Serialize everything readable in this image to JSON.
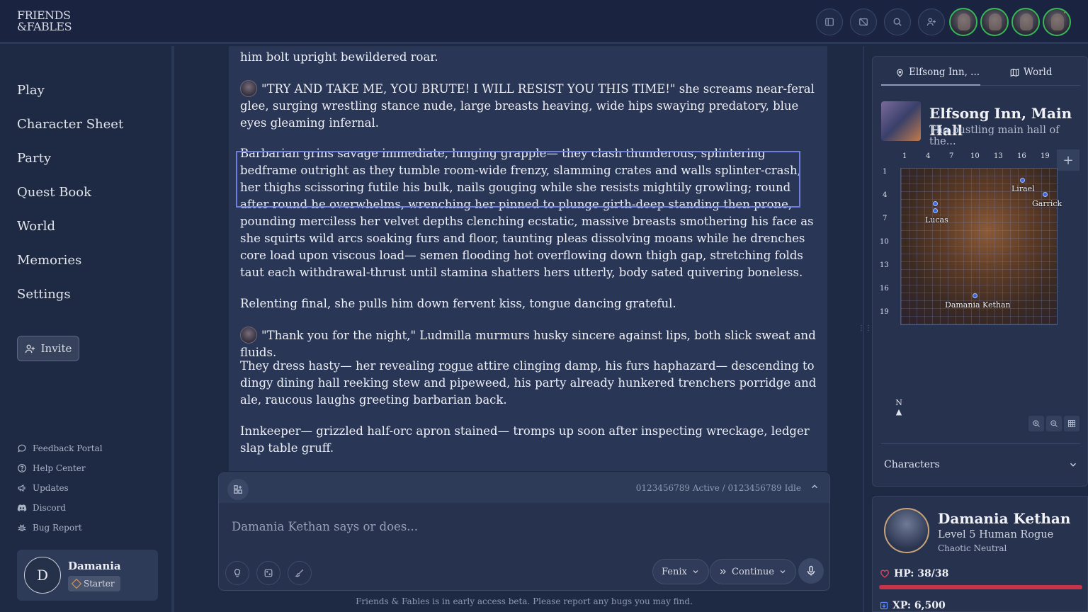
{
  "app": {
    "logo_line1": "FRIENDS",
    "logo_line2": "&FABLES"
  },
  "topbar": {
    "buttons": [
      "sidebar-toggle-icon",
      "hide-image-icon",
      "search-icon",
      "add-user-icon"
    ],
    "avatars": 4
  },
  "sidebar": {
    "nav": [
      "Play",
      "Character Sheet",
      "Party",
      "Quest Book",
      "World",
      "Memories",
      "Settings"
    ],
    "invite_label": "Invite",
    "footer_links": [
      "Feedback Portal",
      "Help Center",
      "Updates",
      "Discord",
      "Bug Report"
    ],
    "user": {
      "initial": "D",
      "name": "Damania",
      "tier": "Starter"
    }
  },
  "story": {
    "p0": "him bolt upright bewildered roar.",
    "p1": "\"TRY AND TAKE ME, YOU BRUTE! I WILL RESIST YOU THIS TIME!\"  she screams near-feral glee, surging wrestling stance nude, large breasts heaving, wide hips swaying predatory, blue eyes gleaming infernal.",
    "p2": "Barbarian grins savage immediate, lunging grapple— they clash thunderous, splintering bedframe outright as they tumble room-wide frenzy, slamming crates and walls splinter-crash, her thighs scissoring futile his bulk, nails gouging while she resists mightily growling; round after round he overwhelms, wrenching her pinned to plunge girth-deep standing then prone, pounding merciless her velvet depths clenching ecstatic, massive breasts smothering his face as she squirts wild arcs soaking furs and floor, taunting pleas dissolving moans while he drenches core load upon viscous load— semen flooding hot overflowing down thigh gap, stretching folds taut each withdrawal-thrust until stamina shatters hers utterly, body sated quivering boneless.",
    "p3": "Relenting final, she pulls him down fervent kiss, tongue dancing grateful.",
    "p4": "\"Thank you for the night,\"  Ludmilla murmurs husky sincere against lips, both slick sweat and fluids.",
    "p5_a": "They dress hasty— her revealing ",
    "p5_link": "rogue",
    "p5_b": " attire clinging damp, his furs haphazard— descending to dingy dining hall reeking stew and pipeweed, his party already hunkered trenchers porridge and ale, raucous laughs greeting barbarian back.",
    "p6": "Innkeeper— grizzled half-orc apron stained— tromps up soon after inspecting wreckage, ledger slap table gruff."
  },
  "input": {
    "status": "0123456789 Active / 0123456789 Idle",
    "placeholder": "Damania Kethan says or does...",
    "model": "Fenix",
    "mode": "Continue",
    "beta_notice": "Friends & Fables is in early access beta. Please report any bugs you may find."
  },
  "location": {
    "tabs": [
      "Elfsong Inn, ...",
      "World"
    ],
    "title": "Elfsong Inn, Main Hall",
    "subtitle": "The bustling main hall of the...",
    "col_labels": [
      "1",
      "4",
      "7",
      "10",
      "13",
      "16",
      "19"
    ],
    "row_labels": [
      "1",
      "4",
      "7",
      "10",
      "13",
      "16",
      "19"
    ],
    "tokens": [
      "Lirael",
      "Garrick",
      "Lucas",
      "Damania Kethan"
    ],
    "compass": "N",
    "characters_label": "Characters"
  },
  "character": {
    "name": "Damania Kethan",
    "level": "Level 5 Human Rogue",
    "alignment": "Chaotic Neutral",
    "hp": "HP: 38/38",
    "hp_fraction": 1.0,
    "xp": "XP: 6,500",
    "colors": {
      "hp": "#c8334a",
      "accent": "#36b857"
    }
  }
}
